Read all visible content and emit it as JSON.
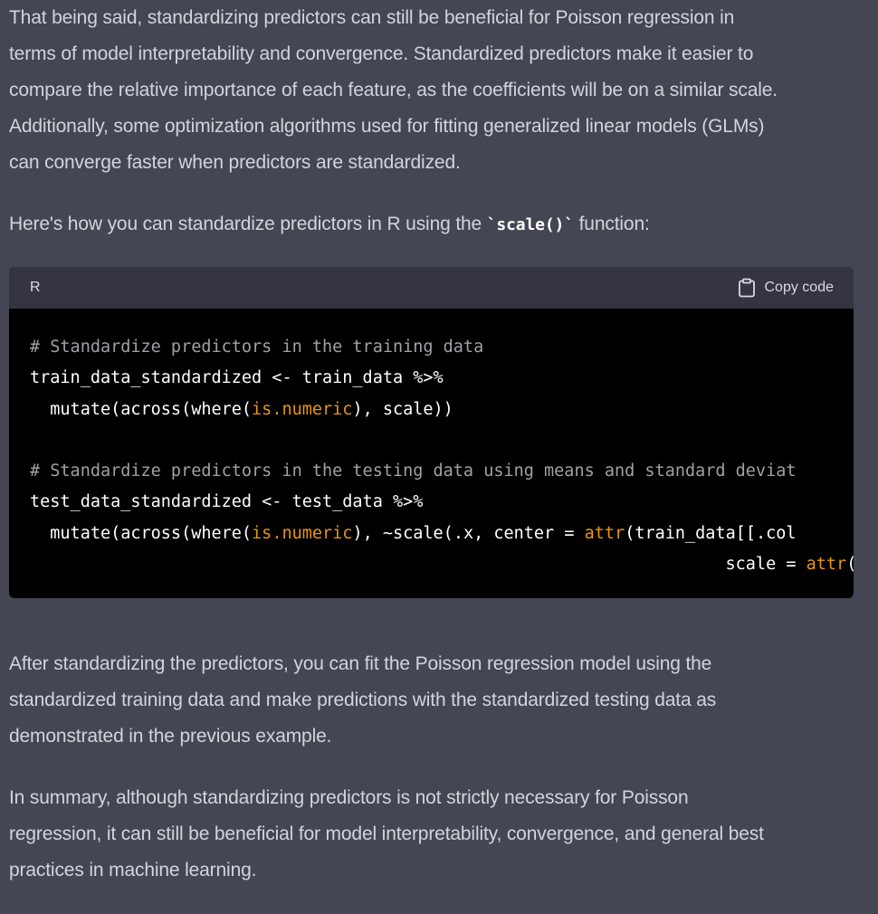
{
  "paragraphs": {
    "p1_lines": [
      "That being said, standardizing predictors can still be beneficial for Poisson regression in",
      "terms of model interpretability and convergence. Standardized predictors make it easier to",
      "compare the relative importance of each feature, as the coefficients will be on a similar scale.",
      "Additionally, some optimization algorithms used for fitting generalized linear models (GLMs)",
      "can converge faster when predictors are standardized."
    ],
    "p2_before": "Here's how you can standardize predictors in R using the ",
    "p2_code": "`scale()`",
    "p2_after": " function:",
    "p3_lines": [
      "After standardizing the predictors, you can fit the Poisson regression model using the",
      "standardized training data and make predictions with the standardized testing data as",
      "demonstrated in the previous example."
    ],
    "p4_lines": [
      "In summary, although standardizing predictors is not strictly necessary for Poisson",
      "regression, it can still be beneficial for model interpretability, convergence, and general best",
      "practices in machine learning."
    ]
  },
  "code_block": {
    "language": "R",
    "copy_label": "Copy code",
    "copy_icon": "clipboard-icon",
    "lines": [
      [
        {
          "t": "comment",
          "v": "# Standardize predictors in the training data"
        }
      ],
      [
        {
          "t": "plain",
          "v": "train_data_standardized <- train_data %>%"
        }
      ],
      [
        {
          "t": "plain",
          "v": "  mutate(across(where("
        },
        {
          "t": "builtin",
          "v": "is.numeric"
        },
        {
          "t": "plain",
          "v": "), scale))"
        }
      ],
      [
        {
          "t": "plain",
          "v": ""
        }
      ],
      [
        {
          "t": "comment",
          "v": "# Standardize predictors in the testing data using means and standard deviat"
        }
      ],
      [
        {
          "t": "plain",
          "v": "test_data_standardized <- test_data %>%"
        }
      ],
      [
        {
          "t": "plain",
          "v": "  mutate(across(where("
        },
        {
          "t": "builtin",
          "v": "is.numeric"
        },
        {
          "t": "plain",
          "v": "), ~scale(.x, center = "
        },
        {
          "t": "builtin",
          "v": "attr"
        },
        {
          "t": "plain",
          "v": "(train_data[[.col"
        }
      ],
      [
        {
          "t": "plain",
          "v": "                                                                     scale = "
        },
        {
          "t": "builtin",
          "v": "attr"
        },
        {
          "t": "plain",
          "v": "(train_data[[.col]], "
        },
        {
          "t": "string",
          "v": "\""
        }
      ]
    ]
  },
  "colors": {
    "background": "#444654",
    "text": "#d1d5db",
    "code_bg": "#000000",
    "code_header_bg": "#343541",
    "comment": "#a0a0a6",
    "builtin": "#e9950c",
    "string": "#00a67d"
  }
}
